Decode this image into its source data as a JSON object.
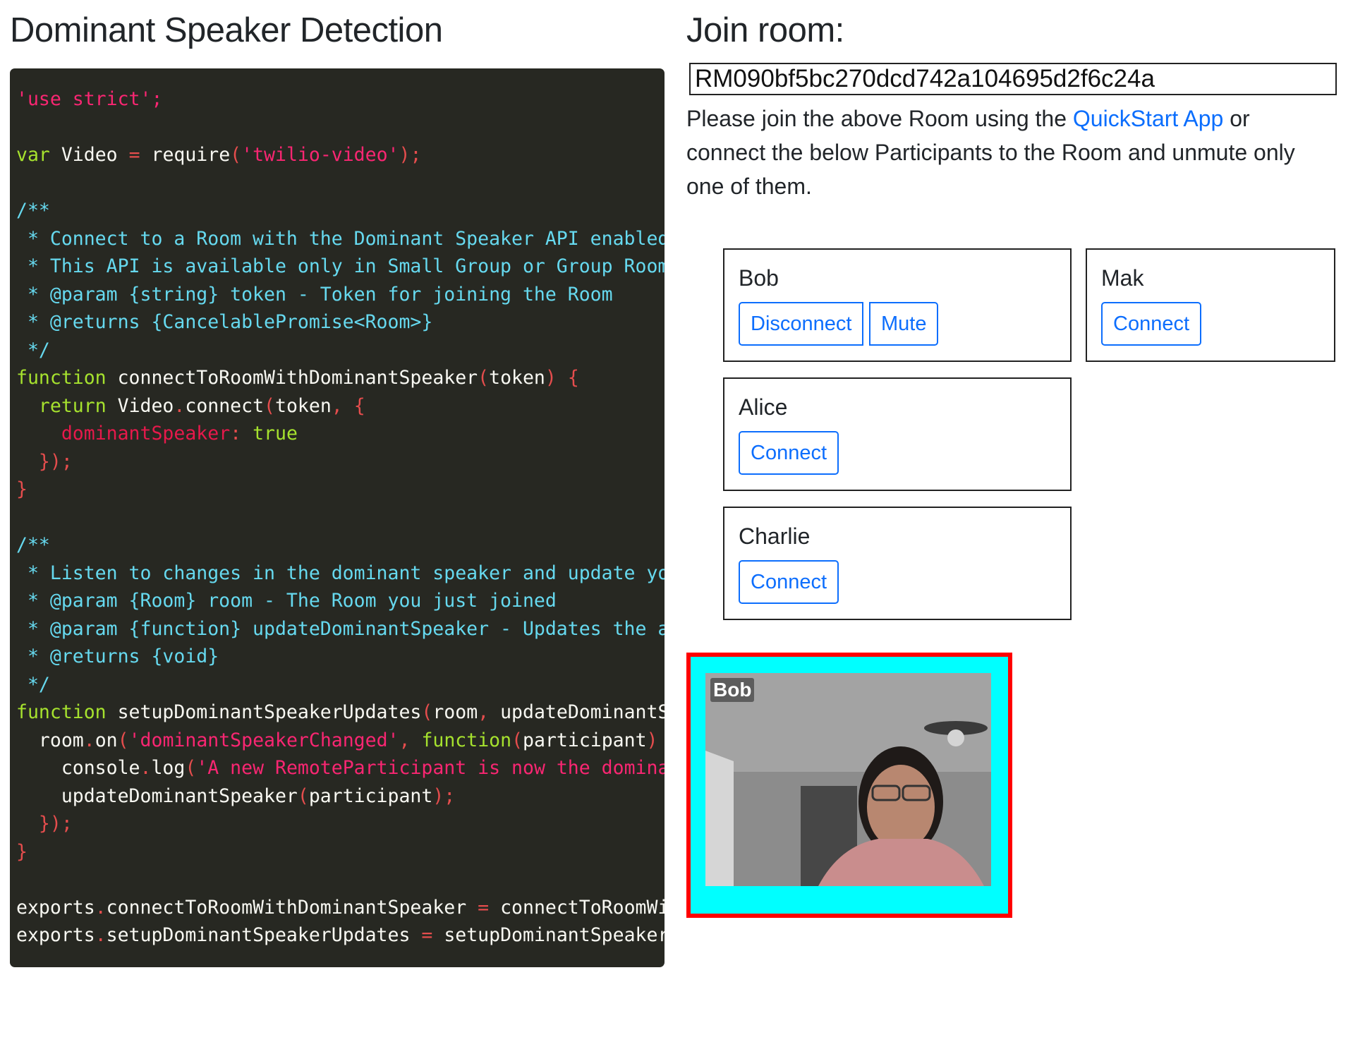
{
  "left": {
    "title": "Dominant Speaker Detection"
  },
  "code": {
    "lines": [
      "'use strict';",
      "",
      "var Video = require('twilio-video');",
      "",
      "/**",
      " * Connect to a Room with the Dominant Speaker API enabled",
      " * This API is available only in Small Group or Group Rooms",
      " * @param {string} token - Token for joining the Room",
      " * @returns {CancelablePromise<Room>}",
      " */",
      "function connectToRoomWithDominantSpeaker(token) {",
      "  return Video.connect(token, {",
      "    dominantSpeaker: true",
      "  });",
      "}",
      "",
      "/**",
      " * Listen to changes in the dominant speaker and update yo",
      " * @param {Room} room - The Room you just joined",
      " * @param {function} updateDominantSpeaker - Updates the a",
      " * @returns {void}",
      " */",
      "function setupDominantSpeakerUpdates(room, updateDominantSp",
      "  room.on('dominantSpeakerChanged', function(participant)",
      "    console.log('A new RemoteParticipant is now the domina",
      "    updateDominantSpeaker(participant);",
      "  });",
      "}",
      "",
      "exports.connectToRoomWithDominantSpeaker = connectToRoomWi",
      "exports.setupDominantSpeakerUpdates = setupDominantSpeaker"
    ]
  },
  "right": {
    "title": "Join room:",
    "room_sid": "RM090bf5bc270dcd742a104695d2f6c24a",
    "instructions_before": "Please join the above Room using the ",
    "instructions_link": "QuickStart App",
    "instructions_after": " or connect the below Participants to the Room and unmute only one of them."
  },
  "participants": {
    "bob": {
      "name": "Bob",
      "disconnect_label": "Disconnect",
      "mute_label": "Mute"
    },
    "mak": {
      "name": "Mak",
      "connect_label": "Connect"
    },
    "alice": {
      "name": "Alice",
      "connect_label": "Connect"
    },
    "charlie": {
      "name": "Charlie",
      "connect_label": "Connect"
    }
  },
  "video": {
    "label": "Bob",
    "dominant_border_color": "#ff0000",
    "track_background_color": "#00ffff"
  }
}
